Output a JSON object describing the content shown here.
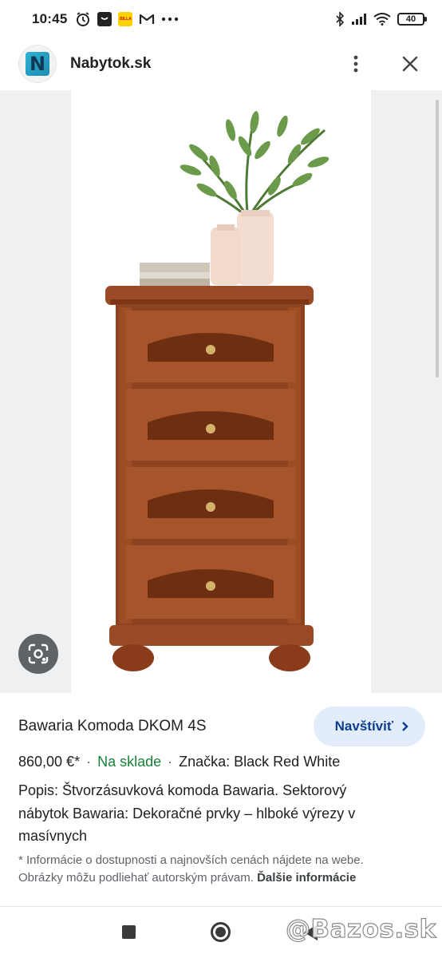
{
  "status_bar": {
    "time": "10:45",
    "battery": "40",
    "left_icons": [
      "alarm-icon",
      "shop-icon",
      "billa-icon",
      "gmail-icon",
      "more-dots-icon"
    ],
    "right_icons": [
      "bluetooth-icon",
      "signal-icon",
      "wifi-icon",
      "battery-icon"
    ]
  },
  "header": {
    "logo_letter": "N",
    "site_name": "Nabytok.sk"
  },
  "product": {
    "title": "Bawaria Komoda DKOM 4S",
    "visit_label": "Navštíviť",
    "price": "860,00 €*",
    "stock": "Na sklade",
    "brand": "Značka: Black Red White",
    "description": "Popis: Štvorzásuvková komoda Bawaria. Sektorový nábytok Bawaria: Dekoračné prvky – hlboké výrezy v masívnych",
    "note": "* Informácie o dostupnosti a najnovších cenách nájdete na webe. Obrázky môžu podliehať autorským právam.",
    "note_link": "Ďalšie informácie"
  },
  "watermark": "@Bazos.sk",
  "colors": {
    "stock_green": "#188038",
    "visit_bg": "#e3ecfb",
    "wood": "#8b3f1e"
  }
}
